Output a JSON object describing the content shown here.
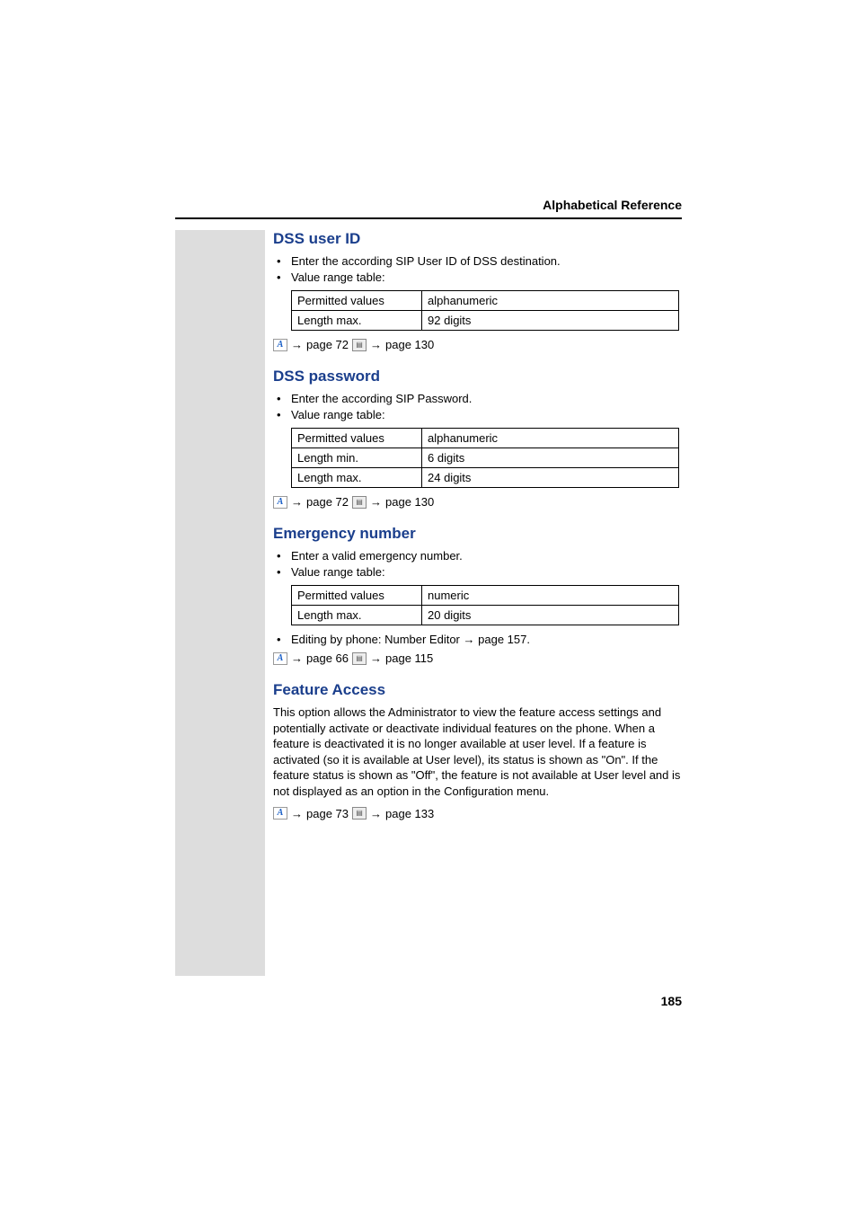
{
  "header": {
    "title": "Alphabetical Reference"
  },
  "page_number": "185",
  "sections": [
    {
      "heading": "DSS user ID",
      "bullets": [
        "Enter the according SIP User ID of DSS destination.",
        "Value range table:"
      ],
      "table": [
        {
          "label": "Permitted values",
          "value": "alphanumeric"
        },
        {
          "label": "Length max.",
          "value": "92 digits"
        }
      ],
      "ref": {
        "admin_page": "page 72",
        "sheet_page": "page 130"
      }
    },
    {
      "heading": "DSS password",
      "bullets": [
        "Enter the according SIP Password.",
        "Value range table:"
      ],
      "table": [
        {
          "label": "Permitted values",
          "value": "alphanumeric"
        },
        {
          "label": "Length min.",
          "value": "6 digits"
        },
        {
          "label": "Length max.",
          "value": "24 digits"
        }
      ],
      "ref": {
        "admin_page": "page 72",
        "sheet_page": "page 130"
      }
    },
    {
      "heading": "Emergency number",
      "bullets": [
        "Enter a valid emergency number.",
        "Value range table:"
      ],
      "table": [
        {
          "label": "Permitted values",
          "value": "numeric"
        },
        {
          "label": "Length max.",
          "value": "20 digits"
        }
      ],
      "editor_note": {
        "prefix": "Editing by phone: Number Editor ",
        "link": "page 157",
        "suffix": "."
      },
      "ref": {
        "admin_page": "page 66",
        "sheet_page": "page 115"
      }
    },
    {
      "heading": "Feature Access",
      "paragraph": "This option allows the Administrator to view the feature access settings and potentially activate or deactivate individual features on the phone. When a feature is deactivated it is no longer available at user level. If a feature is activated (so it is available at User level), its status is shown as \"On\". If the feature status is shown as \"Off\", the feature is not available at User level and is not displayed as an option in the Configuration menu.",
      "ref": {
        "admin_page": "page 73",
        "sheet_page": "page 133"
      }
    }
  ],
  "arrow_glyph": "→",
  "icon_a_glyph": "A",
  "icon_sheet_glyph": "▤"
}
